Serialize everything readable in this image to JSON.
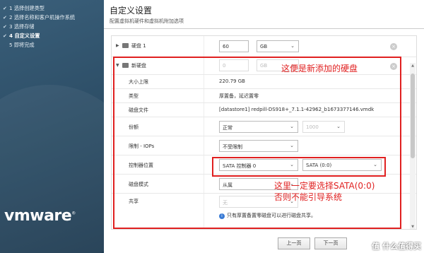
{
  "sidebar": {
    "steps": [
      {
        "label": "1 选择创建类型",
        "done": true
      },
      {
        "label": "2 选择名称和客户机操作系统",
        "done": true
      },
      {
        "label": "3 选择存储",
        "done": true
      },
      {
        "label": "4 自定义设置",
        "done": true,
        "active": true
      },
      {
        "label": "5 即将完成",
        "done": false
      }
    ],
    "logo": "vmware",
    "logo_tm": "®"
  },
  "header": {
    "title": "自定义设置",
    "subtitle": "配置虚拟机硬件和虚拟机附加选项"
  },
  "disk1": {
    "label": "硬盘 1",
    "size": "60",
    "unit": "GB"
  },
  "newdisk": {
    "label": "新硬盘",
    "size": "0",
    "unit": "GB",
    "max_size_label": "大小上限",
    "max_size_value": "220.79 GB",
    "type_label": "类型",
    "type_value": "厚置备，延迟置零",
    "file_label": "磁盘文件",
    "file_value": "[datastore1] redpill-DS918+_7.1.1-42962_b1673377146.vmdk",
    "shares_label": "份额",
    "shares_value": "正常",
    "shares_num": "1000",
    "limit_label": "限制 - IOPs",
    "limit_value": "不受限制",
    "controller_label": "控制器位置",
    "controller_value": "SATA 控制器 0",
    "controller_port": "SATA (0:0)",
    "mode_label": "磁盘模式",
    "mode_value": "从属",
    "sharing_label": "共享",
    "sharing_value": "无",
    "sharing_note": "只有厚置备置零磁盘可以进行磁盘共享。"
  },
  "annotations": {
    "new_disk": "这便是新添加的硬盘",
    "sata_line1": "这里一定要选择SATA(0:0)",
    "sata_line2": "否则不能引导系统"
  },
  "footer": {
    "prev": "上一页",
    "next": "下一页"
  },
  "watermark": "值 什么值得买",
  "colors": {
    "annotation": "#e02020",
    "sidebar": "#2d4d64"
  }
}
